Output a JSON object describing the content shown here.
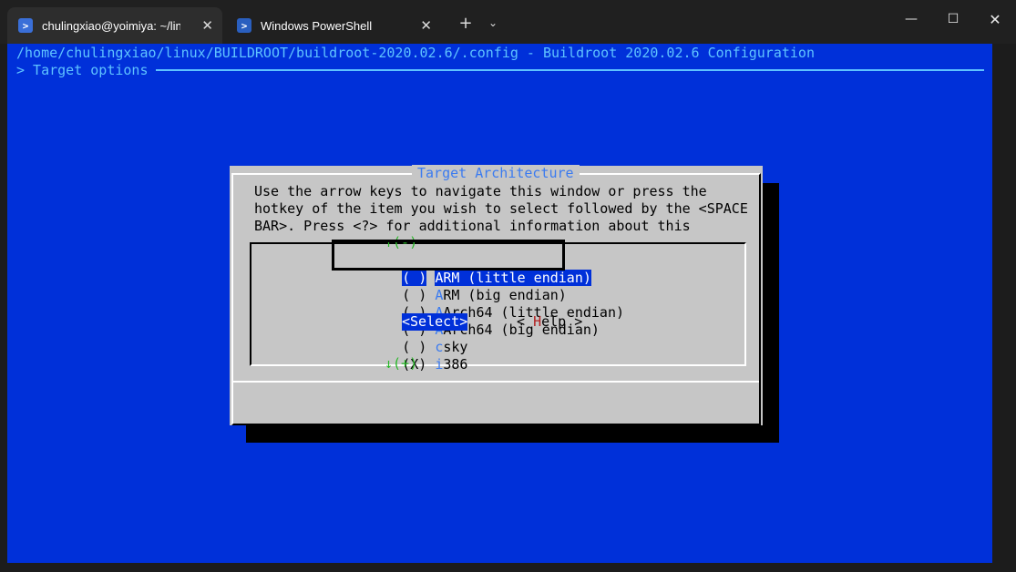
{
  "tabs": [
    {
      "label": "chulingxiao@yoimiya: ~/linux",
      "icon": "linux-terminal-icon",
      "close": "✕"
    },
    {
      "label": "Windows PowerShell",
      "icon": "powershell-icon",
      "close": "✕"
    }
  ],
  "titlebar": {
    "new_tab": "+",
    "dropdown": "⌄",
    "minimize": "—",
    "maximize": "☐",
    "close": "✕"
  },
  "terminal": {
    "header_line": "/home/chulingxiao/linux/BUILDROOT/buildroot-2020.02.6/.config - Buildroot 2020.02.6 Configuration",
    "breadcrumb": "> Target options"
  },
  "dialog": {
    "title": "Target Architecture",
    "help_lines": [
      "Use the arrow keys to navigate this window or press the",
      "hotkey of the item you wish to select followed by the <SPACE",
      "BAR>. Press <?> for additional information about this"
    ],
    "scroll_up": "↑(-)",
    "scroll_down": "↓(+)",
    "items": [
      {
        "mark": "( )",
        "key": "A",
        "rest": "RM (little endian)",
        "selected": true
      },
      {
        "mark": "( )",
        "key": "A",
        "rest": "RM (big endian)",
        "selected": false
      },
      {
        "mark": "( )",
        "key": "A",
        "rest": "Arch64 (little endian)",
        "selected": false
      },
      {
        "mark": "( )",
        "key": "A",
        "rest": "Arch64 (big endian)",
        "selected": false
      },
      {
        "mark": "( )",
        "key": "c",
        "rest": "sky",
        "selected": false
      },
      {
        "mark": "(X)",
        "key": "i",
        "rest": "386",
        "selected": false
      }
    ],
    "buttons": {
      "select": "<Select>",
      "help_open": "< ",
      "help_key": "H",
      "help_rest": "elp >"
    }
  },
  "colors": {
    "terminal_bg": "#0030d9",
    "dialog_bg": "#c6c6c6",
    "accent_text": "#5fc3ff",
    "hotkey": "#3b7bf0"
  }
}
